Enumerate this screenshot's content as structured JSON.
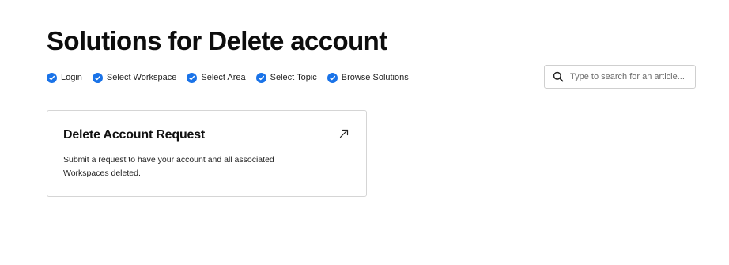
{
  "page": {
    "title": "Solutions for Delete account"
  },
  "steps": [
    {
      "label": "Login",
      "icon": "check-circle-icon"
    },
    {
      "label": "Select Workspace",
      "icon": "check-circle-icon"
    },
    {
      "label": "Select Area",
      "icon": "check-circle-icon"
    },
    {
      "label": "Select Topic",
      "icon": "check-circle-icon"
    },
    {
      "label": "Browse Solutions",
      "icon": "check-circle-icon"
    }
  ],
  "search": {
    "placeholder": "Type to search for an article...",
    "icon": "search-icon"
  },
  "solutions": [
    {
      "title": "Delete Account Request",
      "description": "Submit a request to have your account and all associated Workspaces deleted.",
      "icon": "external-arrow-icon"
    }
  ],
  "colors": {
    "accent": "#1a73e8",
    "text": "#111111",
    "border": "#d5d5d5"
  }
}
